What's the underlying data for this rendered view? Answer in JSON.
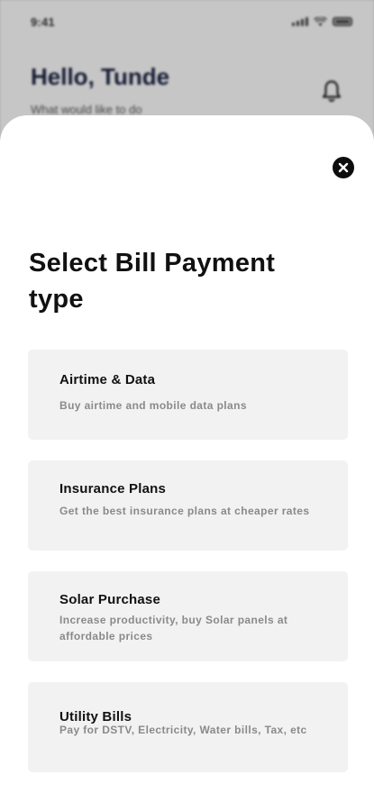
{
  "status_bar": {
    "time": "9:41"
  },
  "background": {
    "greeting": "Hello, Tunde",
    "subtitle": "What would like to do"
  },
  "sheet": {
    "title": "Select Bill Payment type",
    "options": [
      {
        "title": "Airtime & Data",
        "description": "Buy airtime and mobile data plans"
      },
      {
        "title": "Insurance Plans",
        "description": "Get the best insurance plans at cheaper rates"
      },
      {
        "title": "Solar Purchase",
        "description": "Increase productivity, buy Solar panels at affordable prices"
      },
      {
        "title": "Utility Bills",
        "description": "Pay for DSTV, Electricity, Water bills, Tax, etc"
      }
    ]
  },
  "icons": {
    "close": "close-icon",
    "bell": "bell-icon",
    "signal": "signal-icon",
    "wifi": "wifi-icon",
    "battery": "battery-icon"
  },
  "colors": {
    "sheet_bg": "#ffffff",
    "card_bg": "#f2f2f2",
    "title_text": "#111111",
    "desc_text": "#8a8a8a",
    "greeting_text": "#1c2340",
    "close_bg": "#0d0d0d"
  }
}
